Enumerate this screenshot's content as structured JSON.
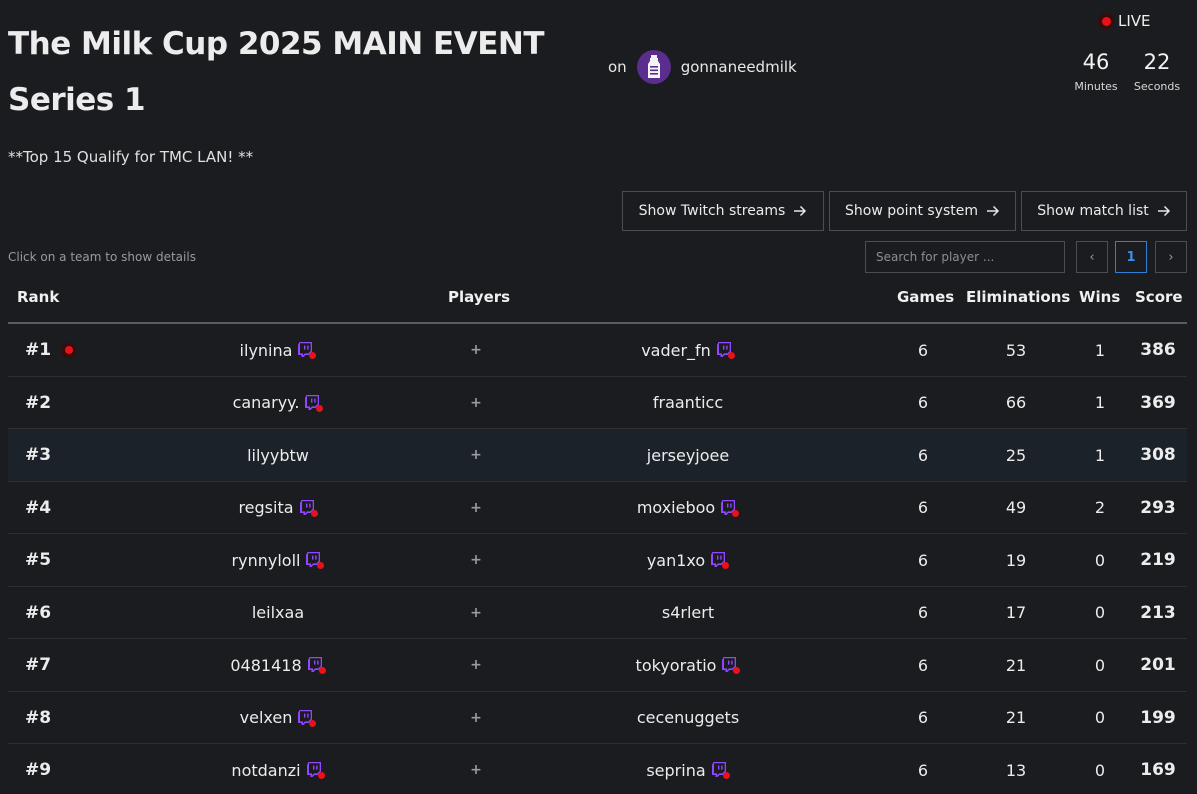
{
  "event": {
    "title": "The Milk Cup 2025 MAIN EVENT Series 1",
    "subtitle": "**Top 15 Qualify for TMC LAN! **"
  },
  "host": {
    "prefix": "on",
    "name": "gonnaneedmilk",
    "avatar_icon": "milk-bottle-icon"
  },
  "live": {
    "label": "LIVE",
    "color": "#e8121b"
  },
  "timer": {
    "minutes": "46",
    "minutes_label": "Minutes",
    "seconds": "22",
    "seconds_label": "Seconds"
  },
  "buttons": {
    "twitch": "Show Twitch streams",
    "points": "Show point system",
    "matches": "Show match list",
    "arrow_icon": "arrow-right-icon"
  },
  "hint": "Click on a team to show details",
  "search": {
    "placeholder": "Search for player ..."
  },
  "pagination": {
    "prev": "‹",
    "current": "1",
    "next": "›",
    "active_color": "#2f7fd8"
  },
  "table": {
    "headers": {
      "rank": "Rank",
      "players": "Players",
      "games": "Games",
      "eliminations": "Eliminations",
      "wins": "Wins",
      "score": "Score"
    },
    "rows": [
      {
        "rank": "#1",
        "live": true,
        "p1": "ilynina",
        "p1_tw": true,
        "p2": "vader_fn",
        "p2_tw": true,
        "games": "6",
        "elims": "53",
        "wins": "1",
        "score": "386"
      },
      {
        "rank": "#2",
        "live": false,
        "p1": "canaryy.",
        "p1_tw": true,
        "p2": "fraanticc",
        "p2_tw": false,
        "games": "6",
        "elims": "66",
        "wins": "1",
        "score": "369"
      },
      {
        "rank": "#3",
        "live": false,
        "p1": "lilyybtw",
        "p1_tw": false,
        "p2": "jerseyjoee",
        "p2_tw": false,
        "games": "6",
        "elims": "25",
        "wins": "1",
        "score": "308"
      },
      {
        "rank": "#4",
        "live": false,
        "p1": "regsita",
        "p1_tw": true,
        "p2": "moxieboo",
        "p2_tw": true,
        "games": "6",
        "elims": "49",
        "wins": "2",
        "score": "293"
      },
      {
        "rank": "#5",
        "live": false,
        "p1": "rynnyloll",
        "p1_tw": true,
        "p2": "yan1xo",
        "p2_tw": true,
        "games": "6",
        "elims": "19",
        "wins": "0",
        "score": "219"
      },
      {
        "rank": "#6",
        "live": false,
        "p1": "leilxaa",
        "p1_tw": false,
        "p2": "s4rlert",
        "p2_tw": false,
        "games": "6",
        "elims": "17",
        "wins": "0",
        "score": "213"
      },
      {
        "rank": "#7",
        "live": false,
        "p1": "0481418",
        "p1_tw": true,
        "p2": "tokyoratio",
        "p2_tw": true,
        "games": "6",
        "elims": "21",
        "wins": "0",
        "score": "201"
      },
      {
        "rank": "#8",
        "live": false,
        "p1": "velxen",
        "p1_tw": true,
        "p2": "cecenuggets",
        "p2_tw": false,
        "games": "6",
        "elims": "21",
        "wins": "0",
        "score": "199"
      },
      {
        "rank": "#9",
        "live": false,
        "p1": "notdanzi",
        "p1_tw": true,
        "p2": "seprina",
        "p2_tw": true,
        "games": "6",
        "elims": "13",
        "wins": "0",
        "score": "169"
      }
    ],
    "plus_glyph": "+",
    "twitch_icon": "twitch-live-icon",
    "twitch_color": "#9146ff",
    "highlight_row": "#3"
  }
}
